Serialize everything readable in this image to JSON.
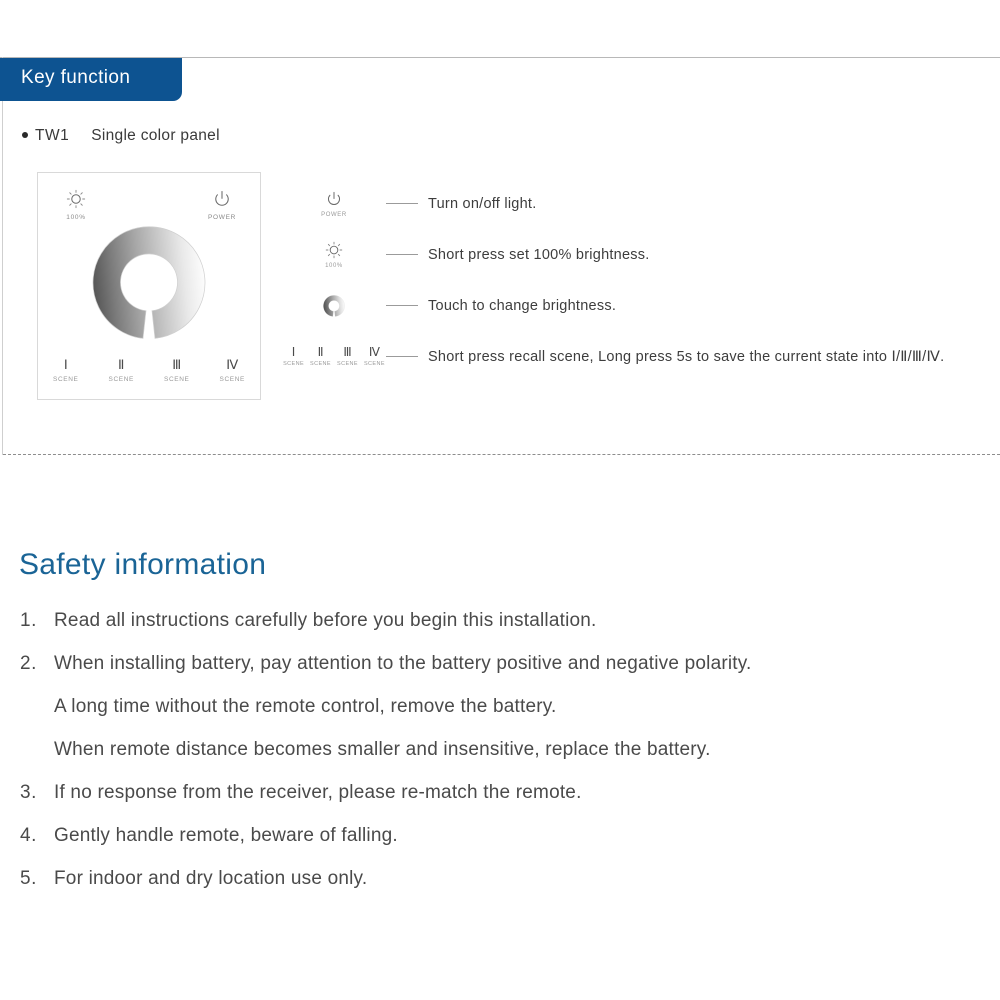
{
  "section": {
    "tab_label": "Key function"
  },
  "model": {
    "bullet_icon": "bullet-dot-icon",
    "code": "TW1",
    "name": "Single color panel"
  },
  "panel": {
    "brightness_button": {
      "icon": "sun-brightness-icon",
      "caption": "100%"
    },
    "power_button": {
      "icon": "power-icon",
      "caption": "POWER"
    },
    "dial": {
      "icon": "brightness-ring-dial-icon",
      "gradient_from": "#6f6f6f",
      "gradient_to": "#ffffff"
    },
    "scenes": [
      {
        "numeral": "Ⅰ",
        "caption": "SCENE"
      },
      {
        "numeral": "Ⅱ",
        "caption": "SCENE"
      },
      {
        "numeral": "Ⅲ",
        "caption": "SCENE"
      },
      {
        "numeral": "Ⅳ",
        "caption": "SCENE"
      }
    ]
  },
  "legend": [
    {
      "icon": "power-icon",
      "caption": "POWER",
      "description": "Turn on/off light."
    },
    {
      "icon": "sun-brightness-icon",
      "caption": "100%",
      "description": "Short press set 100% brightness."
    },
    {
      "icon": "brightness-ring-dial-icon",
      "caption": "",
      "description": "Touch to change brightness."
    },
    {
      "icon": "scene-numerals-icon",
      "caption": "SCENE",
      "description": "Short press recall scene, Long press 5s to save the current state into Ⅰ/Ⅱ/Ⅲ/Ⅳ.",
      "scene_numerals": [
        "Ⅰ",
        "Ⅱ",
        "Ⅲ",
        "Ⅳ"
      ],
      "scene_captions": [
        "SCENE",
        "SCENE",
        "SCENE",
        "SCENE"
      ]
    }
  ],
  "safety": {
    "title": "Safety information",
    "title_color": "#1a6496",
    "items": [
      {
        "number": "1.",
        "lines": [
          "Read all instructions carefully before you begin this installation."
        ]
      },
      {
        "number": "2.",
        "lines": [
          "When installing battery, pay attention to the battery positive and negative polarity.",
          "A long time without the remote control, remove the battery.",
          "When remote distance becomes smaller and insensitive, replace the battery."
        ]
      },
      {
        "number": "3.",
        "lines": [
          "If no response from the receiver, please re-match the remote."
        ]
      },
      {
        "number": "4.",
        "lines": [
          "Gently handle remote, beware of falling."
        ]
      },
      {
        "number": "5.",
        "lines": [
          "For indoor and dry location use only."
        ]
      }
    ]
  },
  "colors": {
    "tab_blue": "#0d5391",
    "heading_blue": "#1a6496",
    "body_gray": "#4a4a4a",
    "rule_gray": "#b8b8b8"
  }
}
